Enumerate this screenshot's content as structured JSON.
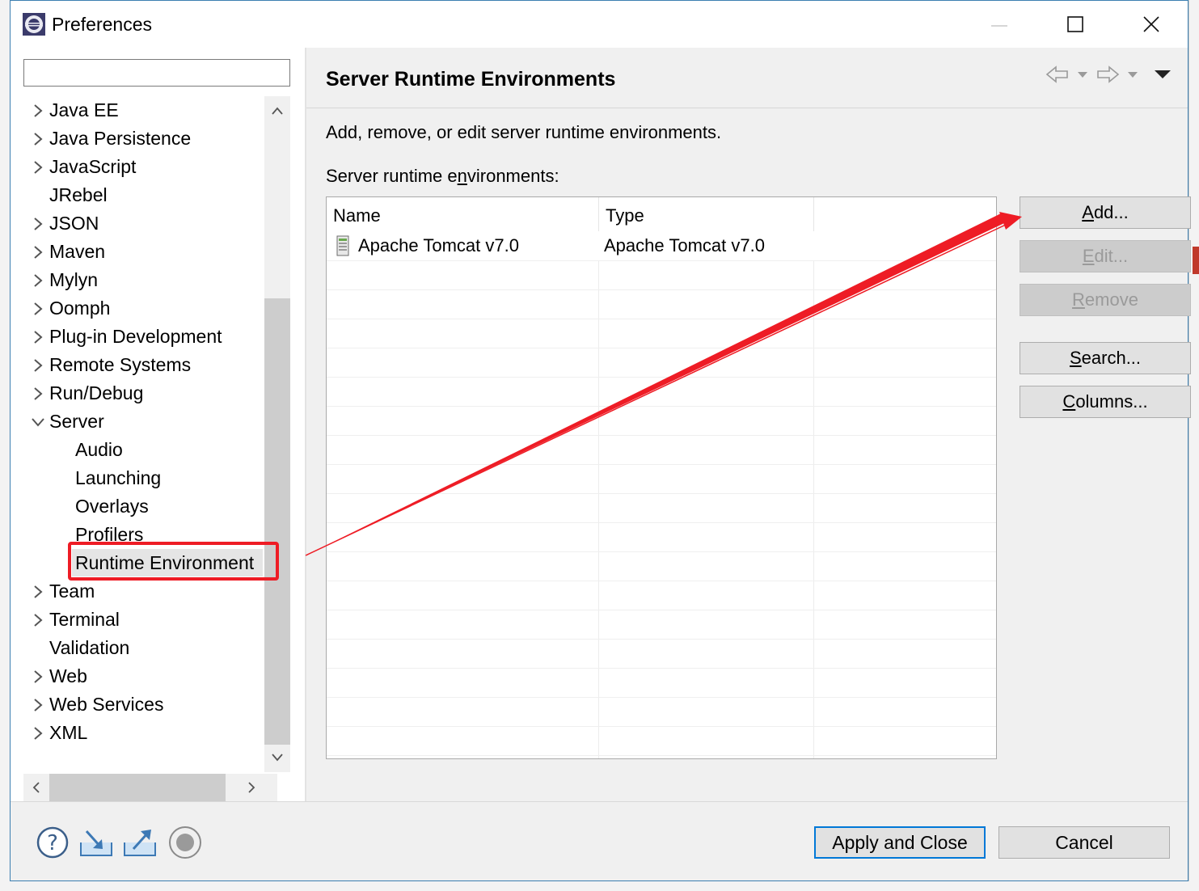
{
  "window": {
    "title": "Preferences",
    "app_icon": "eclipse-icon"
  },
  "filter": {
    "value": "",
    "placeholder": ""
  },
  "tree": {
    "items": [
      {
        "label": "Java EE",
        "chevron": "collapsed",
        "level": 0
      },
      {
        "label": "Java Persistence",
        "chevron": "collapsed",
        "level": 0
      },
      {
        "label": "JavaScript",
        "chevron": "collapsed",
        "level": 0
      },
      {
        "label": "JRebel",
        "chevron": "none",
        "level": 0
      },
      {
        "label": "JSON",
        "chevron": "collapsed",
        "level": 0
      },
      {
        "label": "Maven",
        "chevron": "collapsed",
        "level": 0
      },
      {
        "label": "Mylyn",
        "chevron": "collapsed",
        "level": 0
      },
      {
        "label": "Oomph",
        "chevron": "collapsed",
        "level": 0
      },
      {
        "label": "Plug-in Development",
        "chevron": "collapsed",
        "level": 0
      },
      {
        "label": "Remote Systems",
        "chevron": "collapsed",
        "level": 0
      },
      {
        "label": "Run/Debug",
        "chevron": "collapsed",
        "level": 0
      },
      {
        "label": "Server",
        "chevron": "expanded",
        "level": 0
      },
      {
        "label": "Audio",
        "chevron": "none",
        "level": 1
      },
      {
        "label": "Launching",
        "chevron": "none",
        "level": 1
      },
      {
        "label": "Overlays",
        "chevron": "none",
        "level": 1
      },
      {
        "label": "Profilers",
        "chevron": "none",
        "level": 1
      },
      {
        "label": "Runtime Environment",
        "chevron": "none",
        "level": 1,
        "selected": true
      },
      {
        "label": "Team",
        "chevron": "collapsed",
        "level": 0
      },
      {
        "label": "Terminal",
        "chevron": "collapsed",
        "level": 0
      },
      {
        "label": "Validation",
        "chevron": "none",
        "level": 0
      },
      {
        "label": "Web",
        "chevron": "collapsed",
        "level": 0
      },
      {
        "label": "Web Services",
        "chevron": "collapsed",
        "level": 0
      },
      {
        "label": "XML",
        "chevron": "collapsed",
        "level": 0
      }
    ]
  },
  "page": {
    "title": "Server Runtime Environments",
    "description": "Add, remove, or edit server runtime environments.",
    "table_label": "Server runtime environments:",
    "columns": [
      "Name",
      "Type"
    ],
    "rows": [
      {
        "name": "Apache Tomcat v7.0",
        "type": "Apache Tomcat v7.0",
        "icon": "server-icon"
      }
    ]
  },
  "buttons": {
    "add": "Add...",
    "edit": "Edit...",
    "remove": "Remove",
    "search": "Search...",
    "columns": "Columns..."
  },
  "dialog": {
    "apply_close": "Apply and Close",
    "cancel": "Cancel"
  },
  "annotation": {
    "color": "#ee1c25"
  }
}
